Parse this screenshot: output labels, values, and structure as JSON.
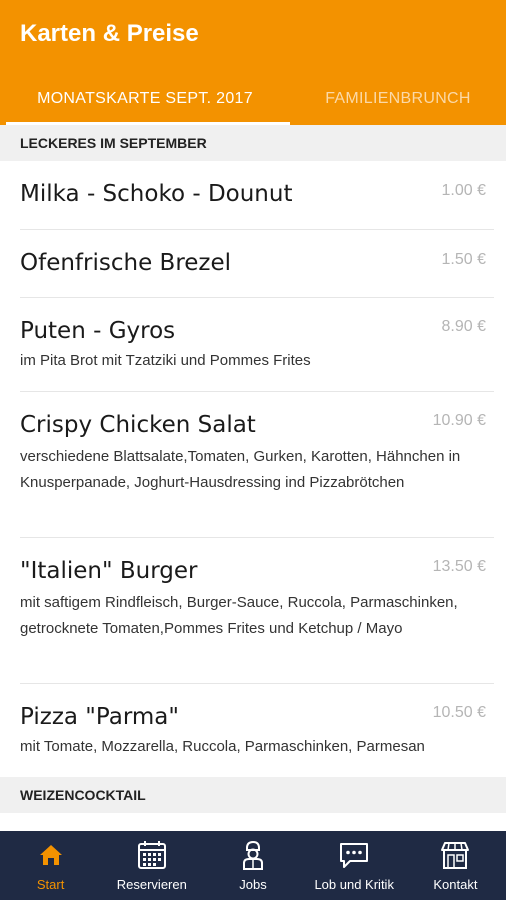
{
  "app": {
    "title": "Karten & Preise"
  },
  "tabs": [
    {
      "label": "MONATSKARTE SEPT. 2017",
      "active": true
    },
    {
      "label": "FAMILIENBRUNCH",
      "active": false
    }
  ],
  "sections": [
    {
      "header": "LECKERES IM SEPTEMBER",
      "items": [
        {
          "name": "Milka - Schoko - Dounut",
          "price": "1.00 €",
          "desc": ""
        },
        {
          "name": "Ofenfrische Brezel",
          "price": "1.50 €",
          "desc": ""
        },
        {
          "name": "Puten - Gyros",
          "price": "8.90 €",
          "desc": "im Pita Brot mit Tzatziki und Pommes Frites"
        },
        {
          "name": "Crispy Chicken Salat",
          "price": "10.90 €",
          "desc": "verschiedene Blattsalate,Tomaten, Gurken, Karotten, Hähnchen in Knusperpanade, Joghurt-Hausdressing ind Pizzabrötchen"
        },
        {
          "name": "\"Italien\" Burger",
          "price": "13.50 €",
          "desc": "mit saftigem Rindfleisch, Burger-Sauce, Ruccola, Parmaschinken, getrocknete Tomaten,Pommes Frites und Ketchup / Mayo"
        },
        {
          "name": "Pizza \"Parma\"",
          "price": "10.50 €",
          "desc": "mit Tomate, Mozzarella, Ruccola, Parmaschinken, Parmesan"
        }
      ]
    },
    {
      "header": "WEIZENCOCKTAIL",
      "items": []
    }
  ],
  "bottom_nav": [
    {
      "label": "Start",
      "icon": "home-icon",
      "active": true
    },
    {
      "label": "Reservieren",
      "icon": "calendar-icon",
      "active": false
    },
    {
      "label": "Jobs",
      "icon": "chef-icon",
      "active": false
    },
    {
      "label": "Lob und Kritik",
      "icon": "chat-icon",
      "active": false
    },
    {
      "label": "Kontakt",
      "icon": "store-icon",
      "active": false
    }
  ],
  "colors": {
    "accent": "#f39200",
    "nav_bg": "#1f2a44",
    "price": "#b5b5b5"
  }
}
